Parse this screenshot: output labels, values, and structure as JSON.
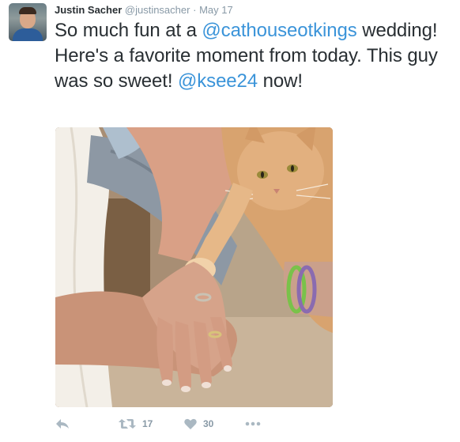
{
  "tweet": {
    "author_name": "Justin Sacher",
    "author_handle": "@justinsacher",
    "separator": "·",
    "date": "May 17",
    "text_part1": "So much fun at a ",
    "mention1": "@cathouseotkings",
    "text_part2": " wedding! Here's a favorite moment from today. This guy was so sweet! ",
    "mention2": "@ksee24",
    "text_part3": " now!",
    "retweet_count": "17",
    "like_count": "30"
  },
  "icons": {
    "reply": "reply-icon",
    "retweet": "retweet-icon",
    "like": "heart-icon",
    "more": "more-dots-icon"
  },
  "colors": {
    "mention": "#3b94d9",
    "text": "#292f33",
    "muted": "#8899a6",
    "icon": "#aab8c2"
  }
}
